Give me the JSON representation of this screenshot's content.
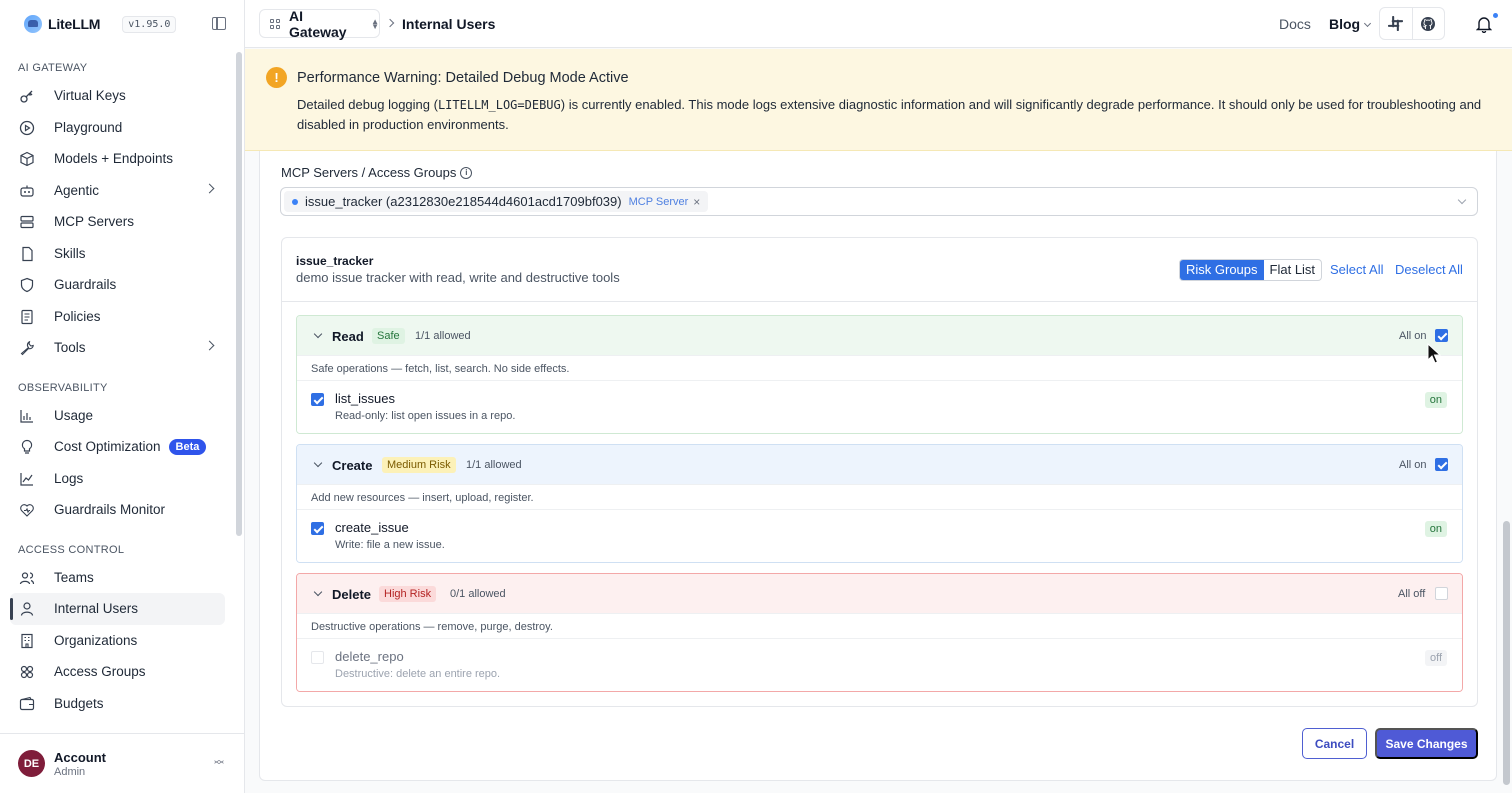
{
  "app": {
    "name": "LiteLLM",
    "version": "v1.95.0"
  },
  "topbar": {
    "gateway": "AI Gateway",
    "breadcrumb": "Internal Users",
    "docs": "Docs",
    "blog": "Blog"
  },
  "sidebar": {
    "sections": [
      {
        "title": "AI GATEWAY",
        "items": [
          {
            "label": "Virtual Keys",
            "icon": "key-icon"
          },
          {
            "label": "Playground",
            "icon": "play-circle-icon"
          },
          {
            "label": "Models + Endpoints",
            "icon": "cube-icon"
          },
          {
            "label": "Agentic",
            "icon": "robot-icon",
            "expandable": true
          },
          {
            "label": "MCP Servers",
            "icon": "server-icon"
          },
          {
            "label": "Skills",
            "icon": "file-icon"
          },
          {
            "label": "Guardrails",
            "icon": "shield-icon"
          },
          {
            "label": "Policies",
            "icon": "document-icon"
          },
          {
            "label": "Tools",
            "icon": "wrench-icon",
            "expandable": true
          }
        ]
      },
      {
        "title": "OBSERVABILITY",
        "items": [
          {
            "label": "Usage",
            "icon": "bar-chart-icon"
          },
          {
            "label": "Cost Optimization",
            "icon": "lightbulb-icon",
            "badge": "Beta"
          },
          {
            "label": "Logs",
            "icon": "line-chart-icon"
          },
          {
            "label": "Guardrails Monitor",
            "icon": "heart-shield-icon"
          }
        ]
      },
      {
        "title": "ACCESS CONTROL",
        "items": [
          {
            "label": "Teams",
            "icon": "team-icon"
          },
          {
            "label": "Internal Users",
            "icon": "user-icon",
            "active": true
          },
          {
            "label": "Organizations",
            "icon": "bank-icon"
          },
          {
            "label": "Access Groups",
            "icon": "cluster-icon"
          },
          {
            "label": "Budgets",
            "icon": "wallet-icon"
          }
        ]
      }
    ],
    "account": {
      "initials": "DE",
      "name": "Account",
      "role": "Admin"
    }
  },
  "warning": {
    "title": "Performance Warning: Detailed Debug Mode Active",
    "body_pre": "Detailed debug logging (",
    "body_code": "LITELLM_LOG=DEBUG",
    "body_post": ") is currently enabled. This mode logs extensive diagnostic information and will significantly degrade performance. It should only be used for troubleshooting and disabled in production environments."
  },
  "form": {
    "field_label": "MCP Servers / Access Groups",
    "selected_tag": {
      "text": "issue_tracker (a2312830e218544d4601acd1709bf039)",
      "kind": "MCP Server"
    },
    "server": {
      "name": "issue_tracker",
      "description": "demo issue tracker with read, write and destructive tools",
      "view_modes": [
        "Risk Groups",
        "Flat List"
      ],
      "active_view": "Risk Groups",
      "select_all": "Select All",
      "deselect_all": "Deselect All",
      "groups": [
        {
          "name": "Read",
          "risk": "Safe",
          "count": "1/1 allowed",
          "toggle_label": "All on",
          "checked": true,
          "description": "Safe operations — fetch, list, search. No side effects.",
          "tools": [
            {
              "name": "list_issues",
              "description": "Read-only: list open issues in a repo.",
              "state": "on",
              "checked": true
            }
          ]
        },
        {
          "name": "Create",
          "risk": "Medium Risk",
          "count": "1/1 allowed",
          "toggle_label": "All on",
          "checked": true,
          "description": "Add new resources — insert, upload, register.",
          "tools": [
            {
              "name": "create_issue",
              "description": "Write: file a new issue.",
              "state": "on",
              "checked": true
            }
          ]
        },
        {
          "name": "Delete",
          "risk": "High Risk",
          "count": "0/1 allowed",
          "toggle_label": "All off",
          "checked": false,
          "description": "Destructive operations — remove, purge, destroy.",
          "tools": [
            {
              "name": "delete_repo",
              "description": "Destructive: delete an entire repo.",
              "state": "off",
              "checked": false
            }
          ]
        }
      ]
    },
    "cancel": "Cancel",
    "save": "Save Changes"
  },
  "colors": {
    "primary": "#2f6fe4",
    "save": "#4f5ad6",
    "warning": "#f2a524"
  }
}
